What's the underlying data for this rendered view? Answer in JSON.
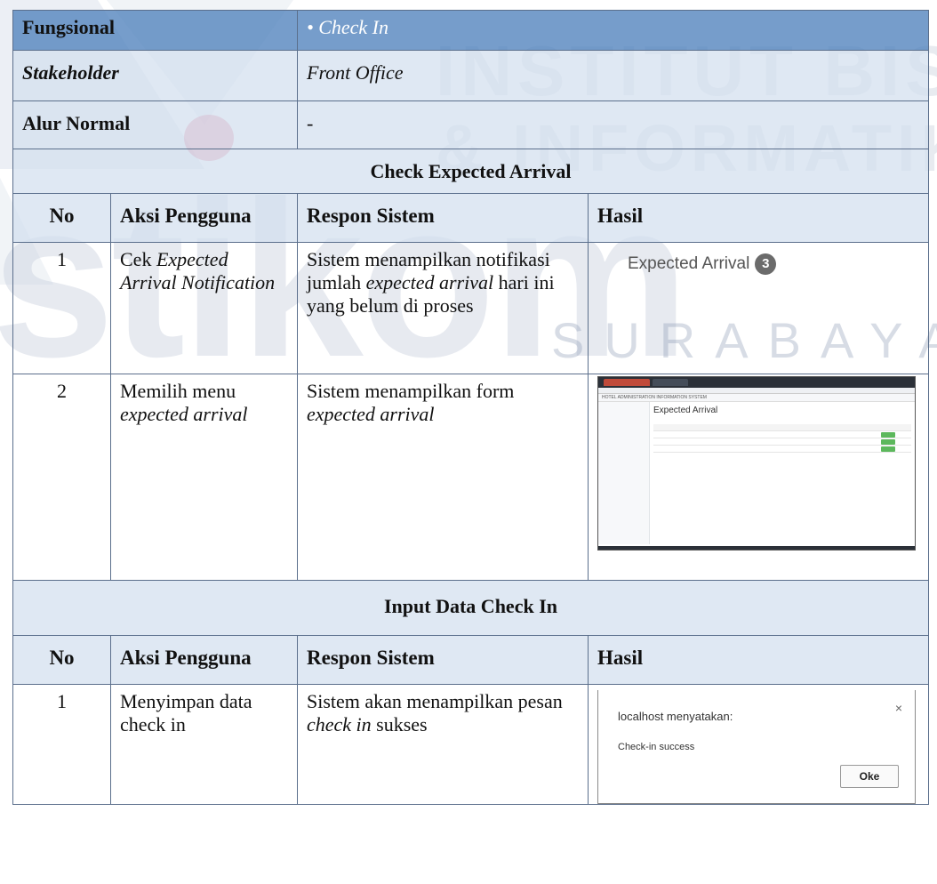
{
  "watermark": {
    "line1": "INSTITUT BISNIS",
    "line2": "& INFORMATIKA",
    "logo": "stikom",
    "line3": "SURABAYA"
  },
  "header": {
    "fungsional_label": "Fungsional",
    "fungsional_value": "• Check In",
    "stakeholder_label": "Stakeholder",
    "stakeholder_value": "Front Office",
    "alur_label": "Alur Normal",
    "alur_value": "-"
  },
  "section1": {
    "title": "Check Expected Arrival",
    "columns": [
      "No",
      "Aksi Pengguna",
      "Respon Sistem",
      "Hasil"
    ],
    "rows": [
      {
        "no": "1",
        "aksi_prefix": "Cek ",
        "aksi_italic": "Expected Arrival Notification",
        "respon_pre": "Sistem menampilkan notifikasi jumlah ",
        "respon_italic": "expected arrival",
        "respon_post": " hari ini yang belum di proses"
      },
      {
        "no": "2",
        "aksi_prefix": "Memilih menu ",
        "aksi_italic": "expected arrival",
        "respon_pre": "Sistem menampilkan form ",
        "respon_italic": "expected arrival",
        "respon_post": ""
      }
    ],
    "hasil1": {
      "label": "Expected Arrival",
      "badge": "3"
    },
    "hasil2": {
      "app_title": "HOTEL ADMINISTRATION INFORMATION SYSTEM",
      "page_title": "Expected Arrival"
    }
  },
  "section2": {
    "title": "Input Data Check In",
    "columns": [
      "No",
      "Aksi Pengguna",
      "Respon Sistem",
      "Hasil"
    ],
    "rows": [
      {
        "no": "1",
        "aksi": "Menyimpan data check in",
        "respon_pre": "Sistem akan menampilkan pesan ",
        "respon_italic": "check in",
        "respon_post": " sukses"
      }
    ],
    "dialog": {
      "title": "localhost menyatakan:",
      "message": "Check-in success",
      "ok": "Oke",
      "close": "×"
    }
  }
}
